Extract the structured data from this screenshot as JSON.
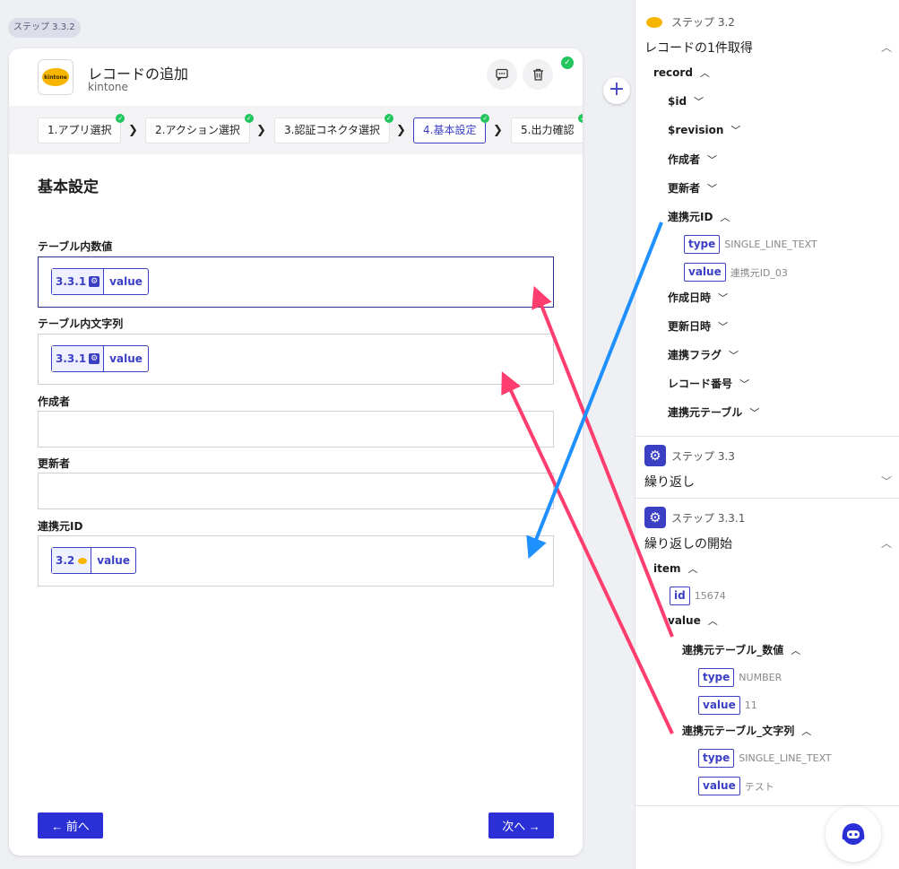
{
  "step_chip": "ステップ 3.3.2",
  "card": {
    "title": "レコードの追加",
    "subtitle": "kintone",
    "logo_text": "kintone",
    "steps": [
      {
        "label": "1.アプリ選択"
      },
      {
        "label": "2.アクション選択"
      },
      {
        "label": "3.認証コネクタ選択"
      },
      {
        "label": "4.基本設定"
      },
      {
        "label": "5.出力確認"
      }
    ],
    "section_title": "基本設定",
    "fields": [
      {
        "label": "テーブル内数値",
        "pill_step": "3.3.1",
        "pill_value": "value"
      },
      {
        "label": "テーブル内文字列",
        "pill_step": "3.3.1",
        "pill_value": "value"
      },
      {
        "label": "作成者"
      },
      {
        "label": "更新者"
      },
      {
        "label": "連携元ID",
        "pill_step": "3.2",
        "pill_value": "value"
      }
    ],
    "prev_label": "← 前へ",
    "next_label": "次へ →"
  },
  "panel": {
    "s32": {
      "head": "ステップ 3.2",
      "title": "レコードの1件取得",
      "record": "record",
      "items": [
        "$id",
        "$revision",
        "作成者",
        "更新者",
        "連携元ID",
        "作成日時",
        "更新日時",
        "連携フラグ",
        "レコード番号",
        "連携元テーブル"
      ],
      "renkei_type_key": "type",
      "renkei_type_val": "SINGLE_LINE_TEXT",
      "renkei_value_key": "value",
      "renkei_value_val": "連携元ID_03"
    },
    "s33": {
      "head": "ステップ 3.3",
      "title": "繰り返し"
    },
    "s331": {
      "head": "ステップ 3.3.1",
      "title": "繰り返しの開始",
      "item": "item",
      "id_key": "id",
      "id_val": "15674",
      "value_node": "value",
      "num_node": "連携元テーブル_数値",
      "num_type_key": "type",
      "num_type_val": "NUMBER",
      "num_value_key": "value",
      "num_value_val": "11",
      "str_node": "連携元テーブル_文字列",
      "str_type_key": "type",
      "str_type_val": "SINGLE_LINE_TEXT",
      "str_value_key": "value",
      "str_value_val": "テスト"
    }
  },
  "colors": {
    "accent": "#3b3fc4",
    "primary_button": "#2b2fd6",
    "arrow_pink": "#ff3d6e",
    "arrow_blue": "#1e90ff",
    "check_green": "#22c55e",
    "kintone_yellow": "#f7b500"
  },
  "icons": [
    "comment-icon",
    "trash-icon",
    "check-icon",
    "plus-icon",
    "gear-icon",
    "kintone-logo",
    "chevron-down-icon",
    "chevron-up-icon",
    "chevron-right-icon",
    "help-bot-icon"
  ]
}
